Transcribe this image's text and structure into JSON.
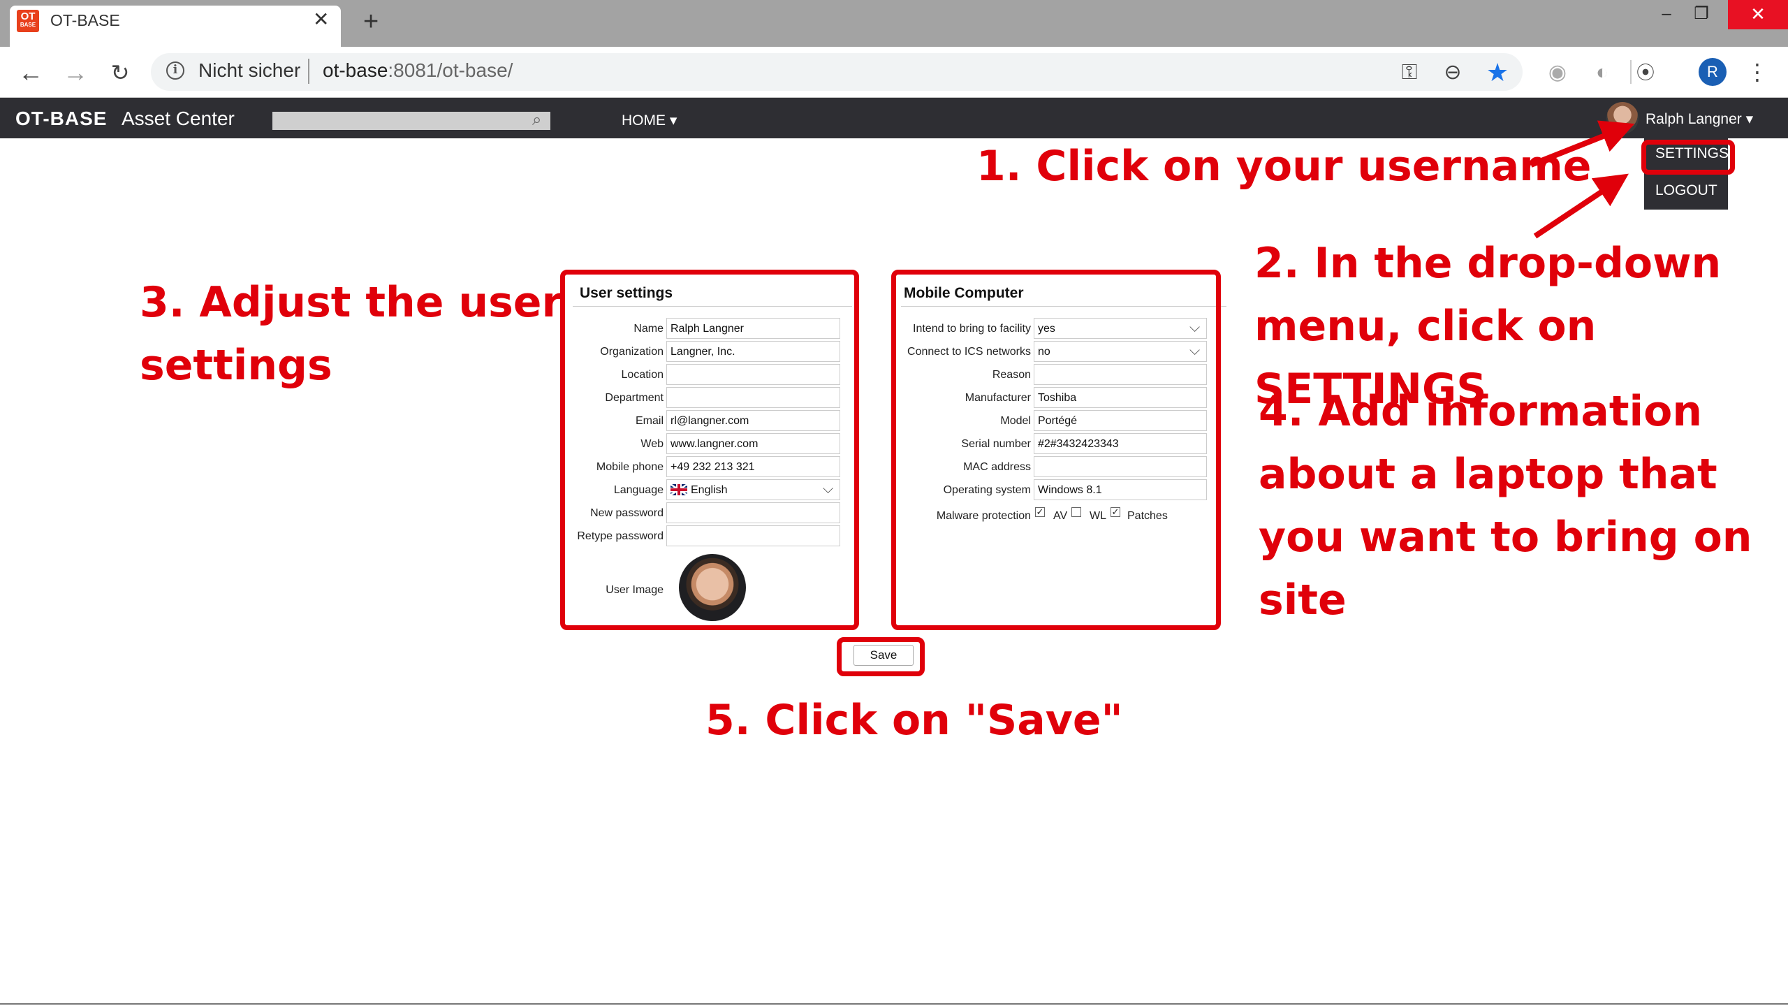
{
  "browser": {
    "favicon_text": "OT",
    "favicon_sub": "BASE",
    "tab_title": "OT-BASE",
    "security_label": "Nicht sicher",
    "url_host": "ot-base",
    "url_rest": ":8081/ot-base/",
    "profile_initial": "R",
    "icons": [
      "back-icon",
      "forward-icon",
      "reload-icon",
      "info-icon",
      "key-icon",
      "zoom-icon",
      "star-icon",
      "extension-icon",
      "menu-icon"
    ]
  },
  "app": {
    "brand": "OT-BASE",
    "brand_sub": "Asset Center",
    "home_menu": "HOME ▾",
    "user_name": "Ralph Langner ▾",
    "menu": {
      "settings": "SETTINGS",
      "logout": "LOGOUT"
    }
  },
  "user_settings": {
    "title": "User settings",
    "fields": [
      {
        "label": "Name",
        "value": "Ralph Langner"
      },
      {
        "label": "Organization",
        "value": "Langner, Inc."
      },
      {
        "label": "Location",
        "value": ""
      },
      {
        "label": "Department",
        "value": ""
      },
      {
        "label": "Email",
        "value": "rl@langner.com"
      },
      {
        "label": "Web",
        "value": "www.langner.com"
      },
      {
        "label": "Mobile phone",
        "value": "+49 232 213 321"
      },
      {
        "label": "Language",
        "value": "English"
      },
      {
        "label": "New password",
        "value": ""
      },
      {
        "label": "Retype password",
        "value": ""
      }
    ],
    "image_label": "User Image"
  },
  "mobile_computer": {
    "title": "Mobile Computer",
    "fields": [
      {
        "label": "Intend to bring to facility",
        "value": "yes"
      },
      {
        "label": "Connect to ICS networks",
        "value": "no"
      },
      {
        "label": "Reason",
        "value": ""
      },
      {
        "label": "Manufacturer",
        "value": "Toshiba"
      },
      {
        "label": "Model",
        "value": "Portégé"
      },
      {
        "label": "Serial number",
        "value": "#2#3432423343"
      },
      {
        "label": "MAC address",
        "value": ""
      },
      {
        "label": "Operating system",
        "value": "Windows 8.1"
      }
    ],
    "malware_label": "Malware protection",
    "checks": [
      {
        "label": "AV",
        "checked": true
      },
      {
        "label": "WL",
        "checked": false
      },
      {
        "label": "Patches",
        "checked": true
      }
    ]
  },
  "save_label": "Save",
  "annotations": {
    "step1": "1. Click on your username",
    "step2_line1": "2. In the drop-down",
    "step2_line2": "menu, click on SETTINGS",
    "step3_line1": "3. Adjust the user",
    "step3_line2": "settings",
    "step4_line1": "4. Add information",
    "step4_line2": "about a laptop that",
    "step4_line3": "you want to bring on",
    "step4_line4": "site",
    "step5": "5. Click on \"Save\"",
    "color": "#e0000a"
  }
}
